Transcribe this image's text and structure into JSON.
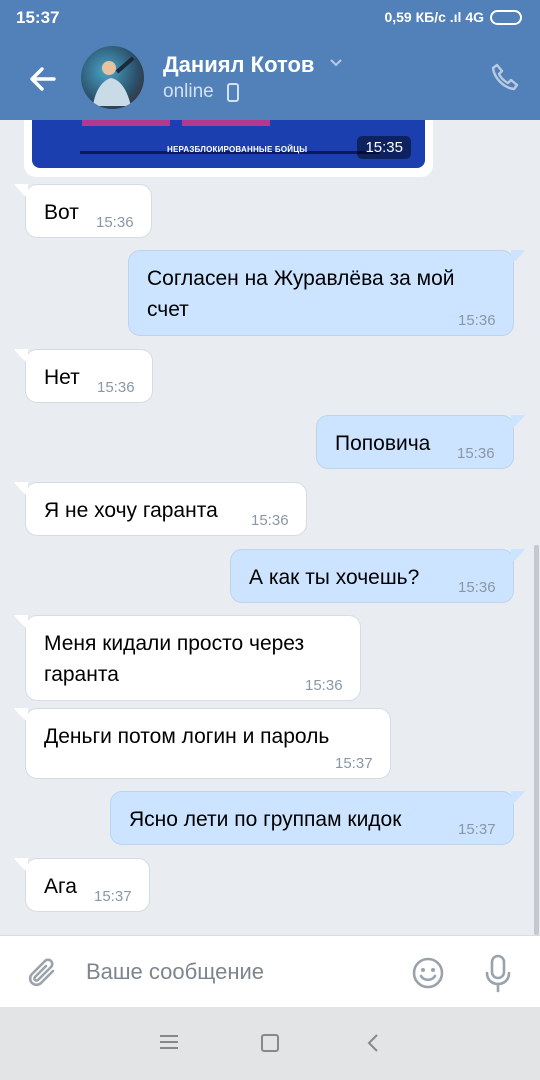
{
  "statusbar": {
    "time": "15:37",
    "network": "0,59 КБ/с .ıl 4G"
  },
  "header": {
    "contact_name": "Даниял Котов",
    "status": "online"
  },
  "image_message": {
    "caption": "НЕРАЗБЛОКИРОВАННЫЕ БОЙЦЫ",
    "time": "15:35"
  },
  "messages": [
    {
      "dir": "in",
      "lines": [
        "Вот"
      ],
      "time": "15:36"
    },
    {
      "dir": "out",
      "lines": [
        "Согласен на Журавлёва за мой",
        "счет"
      ],
      "time": "15:36"
    },
    {
      "dir": "in",
      "lines": [
        "Нет"
      ],
      "time": "15:36"
    },
    {
      "dir": "out",
      "lines": [
        "Поповича"
      ],
      "time": "15:36"
    },
    {
      "dir": "in",
      "lines": [
        "Я не хочу гаранта"
      ],
      "time": "15:36"
    },
    {
      "dir": "out",
      "lines": [
        "А как ты хочешь?"
      ],
      "time": "15:36"
    },
    {
      "dir": "in",
      "lines": [
        "Меня кидали просто через",
        "гаранта"
      ],
      "time": "15:36"
    },
    {
      "dir": "in",
      "lines": [
        "Деньги потом логин и пароль"
      ],
      "time": "15:37"
    },
    {
      "dir": "out",
      "lines": [
        "Ясно лети по группам кидок"
      ],
      "time": "15:37"
    },
    {
      "dir": "in",
      "lines": [
        "Ага"
      ],
      "time": "15:37"
    }
  ],
  "composer": {
    "placeholder": "Ваше сообщение"
  },
  "colors": {
    "header": "#5181b8",
    "incoming": "#ffffff",
    "outgoing": "#cce4ff",
    "background": "#e9edf1"
  },
  "icons": [
    "back-arrow-icon",
    "chevron-down-icon",
    "mobile-phone-icon",
    "call-icon",
    "attach-icon",
    "emoji-icon",
    "microphone-icon",
    "menu-icon",
    "home-icon",
    "back-icon"
  ]
}
